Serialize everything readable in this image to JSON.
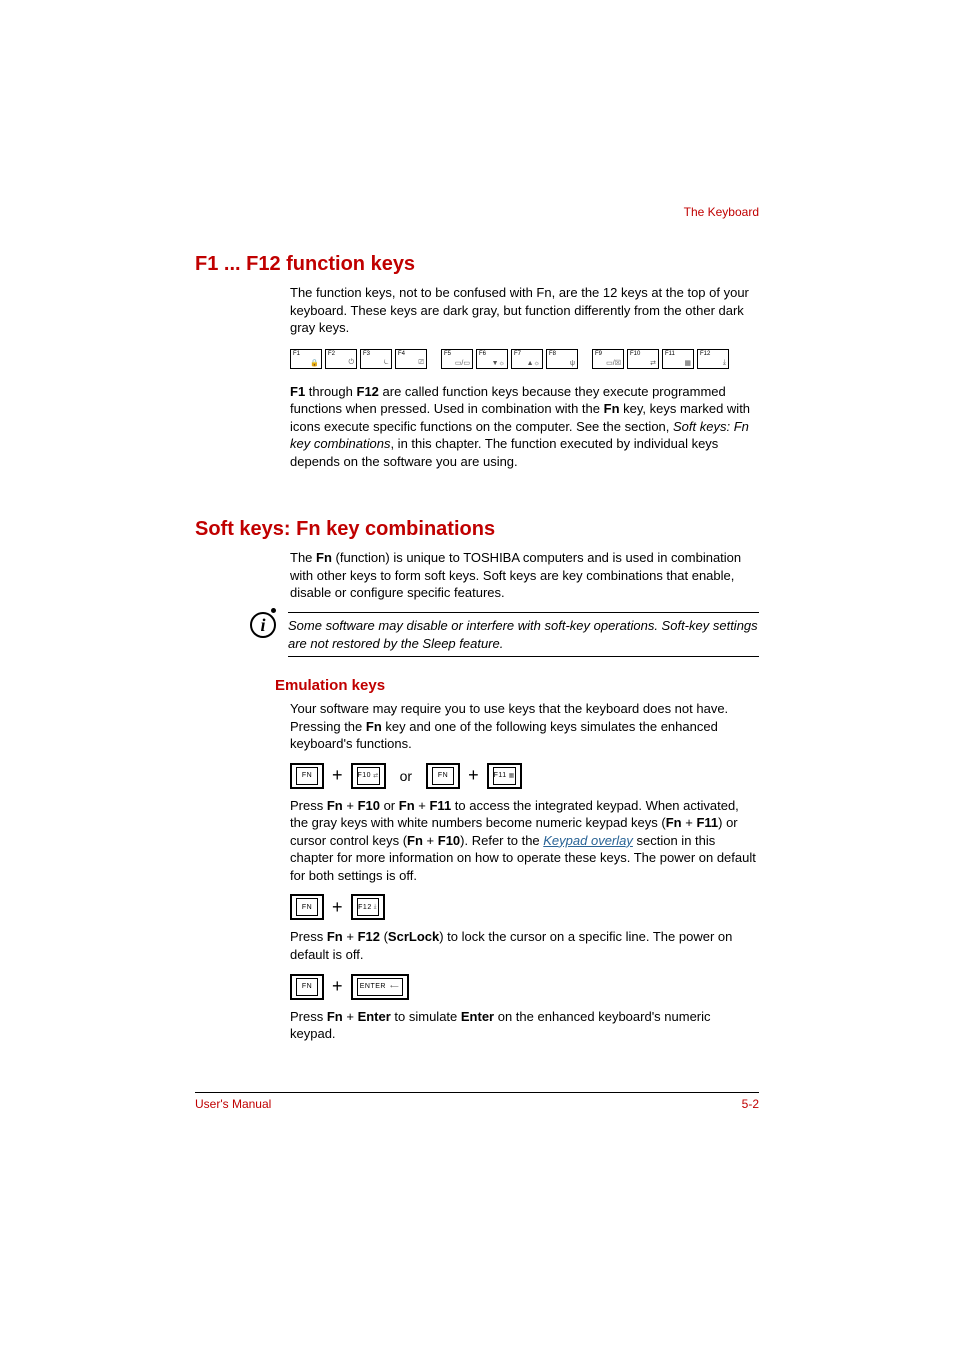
{
  "header": {
    "section": "The Keyboard"
  },
  "h1_a": "F1 ... F12 function keys",
  "p1": "The function keys, not to be confused with Fn, are the 12 keys at the top of your keyboard. These keys are dark gray, but function differently from the other dark gray keys.",
  "fkeys": [
    "F1",
    "F2",
    "F3",
    "F4",
    "F5",
    "F6",
    "F7",
    "F8",
    "F9",
    "F10",
    "F11",
    "F12"
  ],
  "p2_a": "F1",
  "p2_b": " through ",
  "p2_c": "F12",
  "p2_d": " are called function keys because they execute programmed functions when pressed. Used in combination with the ",
  "p2_e": "Fn",
  "p2_f": " key, keys marked with icons execute specific functions on the computer. See the section, ",
  "p2_g": "Soft keys: Fn key combinations",
  "p2_h": ", in this chapter. The function executed by individual keys depends on the software you are using.",
  "h1_b": "Soft keys: Fn key combinations",
  "p3_a": "The ",
  "p3_b": "Fn",
  "p3_c": " (function) is unique to TOSHIBA computers and is used in combination with other keys to form soft keys. Soft keys are key combinations that enable, disable or configure specific features.",
  "note": "Some software may disable or interfere with soft-key operations. Soft-key settings are not restored by the Sleep feature.",
  "h2_a": "Emulation keys",
  "p4_a": "Your software may require you to use keys that the keyboard does not have. Pressing the ",
  "p4_b": "Fn",
  "p4_c": " key and one of the following keys simulates the enhanced keyboard's functions.",
  "keys": {
    "fn": "FN",
    "f10": "F10",
    "f11": "F11",
    "f12": "F12",
    "enter": "ENTER",
    "or": "or",
    "plus": "+"
  },
  "p5_a": "Press ",
  "p5_b": "Fn",
  "p5_c": " + ",
  "p5_d": "F10",
  "p5_e": " or ",
  "p5_f": "Fn",
  "p5_g": " + ",
  "p5_h": "F11",
  "p5_i": " to access the integrated keypad. When activated, the gray keys with white numbers become numeric keypad keys (",
  "p5_j": "Fn",
  "p5_k": " + ",
  "p5_l": "F11",
  "p5_m": ") or cursor control keys (",
  "p5_n": "Fn",
  "p5_o": " + ",
  "p5_p": "F10",
  "p5_q": "). Refer to the ",
  "p5_link": "Keypad overlay",
  "p5_r": " section in this chapter for more information on how to operate these keys. The power on default for both settings is off.",
  "p6_a": "Press ",
  "p6_b": "Fn",
  "p6_c": " + ",
  "p6_d": "F12",
  "p6_e": " (",
  "p6_f": "ScrLock",
  "p6_g": ") to lock the cursor on a specific line. The power on default is off.",
  "p7_a": "Press ",
  "p7_b": "Fn",
  "p7_c": " + ",
  "p7_d": "Enter",
  "p7_e": " to simulate ",
  "p7_f": "Enter",
  "p7_g": " on the enhanced keyboard's numeric keypad.",
  "footer": {
    "left": "User's Manual",
    "right": "5-2"
  }
}
